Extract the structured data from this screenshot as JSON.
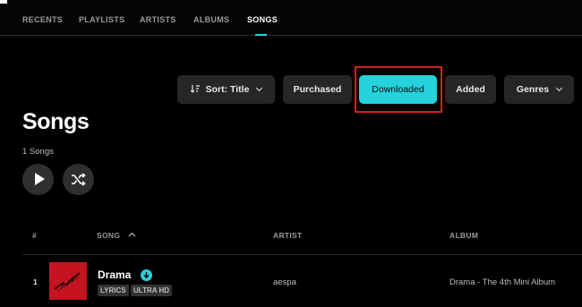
{
  "tabs": [
    {
      "label": "RECENTS"
    },
    {
      "label": "PLAYLISTS"
    },
    {
      "label": "ARTISTS"
    },
    {
      "label": "ALBUMS"
    },
    {
      "label": "SONGS",
      "active": true
    }
  ],
  "toolbar": {
    "sort_label": "Sort: Title",
    "sort_icon": "sort-icon",
    "purchased_label": "Purchased",
    "downloaded_label": "Downloaded",
    "added_label": "Added",
    "genres_label": "Genres"
  },
  "page": {
    "title": "Songs",
    "count": "1 Songs"
  },
  "table": {
    "headers": {
      "num": "#",
      "song": "SONG",
      "artist": "ARTIST",
      "album": "ALBUM"
    },
    "rows": [
      {
        "num": "1",
        "title": "Drama",
        "badges": [
          "LYRICS",
          "ULTRA HD"
        ],
        "artist": "aespa",
        "album": "Drama - The 4th Mini Album"
      }
    ]
  },
  "colors": {
    "accent": "#25d1da",
    "highlight": "#d32020",
    "background": "#000000",
    "button": "#262626"
  }
}
